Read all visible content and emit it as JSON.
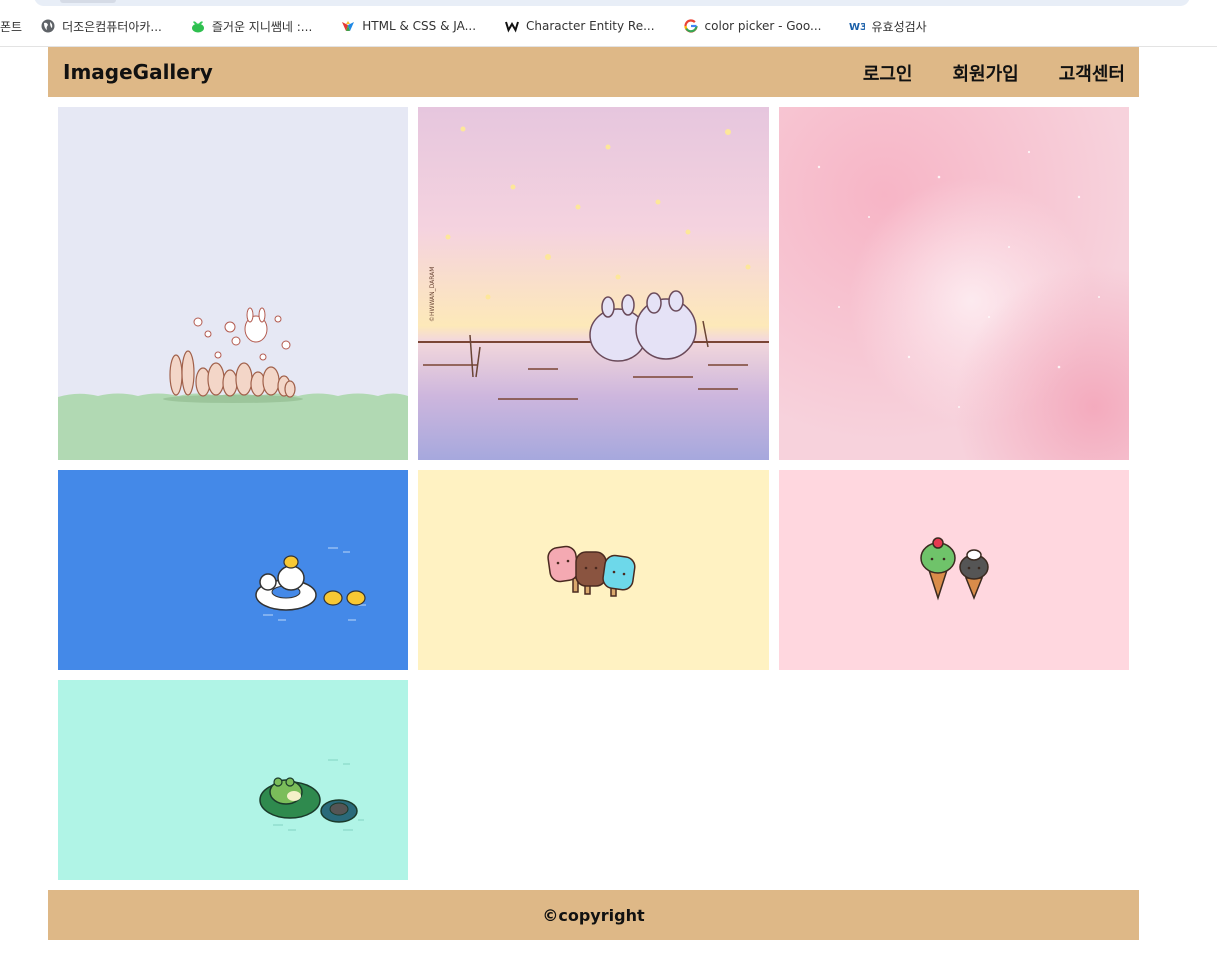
{
  "bookmarks": [
    {
      "label": "폰트",
      "icon": "none"
    },
    {
      "label": "더조은컴퓨터아카...",
      "icon": "globe-icon"
    },
    {
      "label": "즐거운 지니쌤네 :...",
      "icon": "leaf-icon"
    },
    {
      "label": "HTML & CSS & JA...",
      "icon": "colorful-bird-icon"
    },
    {
      "label": "Character Entity Re...",
      "icon": "w-icon"
    },
    {
      "label": "color picker - Goo...",
      "icon": "google-g-icon"
    },
    {
      "label": "유효성검사",
      "icon": "w3-icon"
    }
  ],
  "header": {
    "logo": "ImageGallery",
    "nav": [
      "로그인",
      "회원가입",
      "고객센터"
    ]
  },
  "gallery": {
    "images": [
      {
        "name": "bunnies-on-grass",
        "bg": "#e6e8f4",
        "ground": "#b1d9b3"
      },
      {
        "name": "twin-bunnies-sunset",
        "bg": "#f4d1e0"
      },
      {
        "name": "pink-watercolor",
        "bg": "#f7c9d3"
      },
      {
        "name": "ducks-on-float",
        "bg": "#4489e8"
      },
      {
        "name": "popsicles",
        "bg": "#fff2c2"
      },
      {
        "name": "ice-cream-cones",
        "bg": "#ffd7df"
      },
      {
        "name": "frog-on-lily-pad",
        "bg": "#b0f4e6"
      }
    ]
  },
  "footer": {
    "text": "©copyright"
  },
  "colors": {
    "header_bg": "#deb887",
    "footer_bg": "#deb887"
  }
}
